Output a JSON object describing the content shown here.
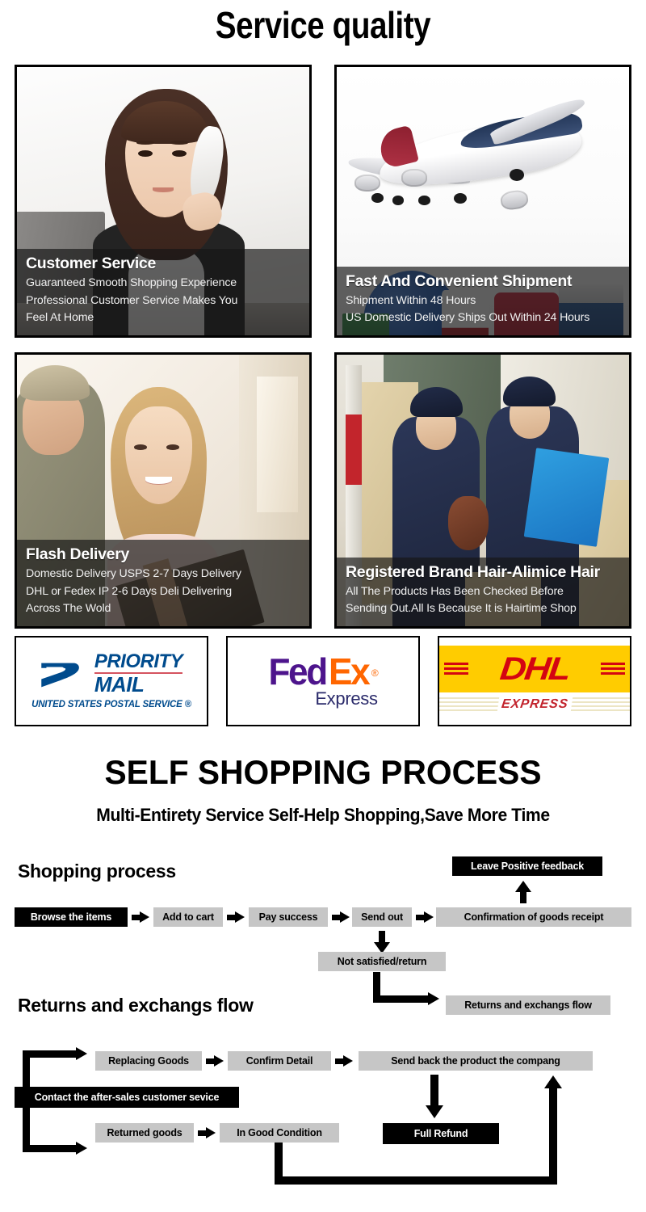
{
  "page": {
    "main_title": "Service quality"
  },
  "feature_cards": [
    {
      "id": "customer-service",
      "title": "Customer Service",
      "lines": [
        "Guaranteed Smooth Shopping Experience",
        "Professional Customer Service Makes You",
        "Feel At Home"
      ],
      "image_description": "customer-service-representative-on-phone"
    },
    {
      "id": "fast-shipment",
      "title": "Fast And Convenient Shipment",
      "lines": [
        "Shipment Within 48 Hours",
        "US Domestic Delivery Ships Out Within 24 Hours"
      ],
      "image_description": "airplane-globe-ship-truck-logistics"
    },
    {
      "id": "flash-delivery",
      "title": "Flash Delivery",
      "lines": [
        "Domestic Delivery USPS 2-7 Days Delivery",
        "DHL or Fedex IP 2-6 Days Deli Delivering",
        "Across The Wold"
      ],
      "image_description": "courier-handing-package-to-woman-at-door"
    },
    {
      "id": "registered-brand",
      "title": "Registered Brand Hair-Alimice Hair",
      "lines": [
        "All The Products Has Been Checked Before",
        "Sending Out.All Is Because It is Hairtime Shop"
      ],
      "image_description": "customs-inspectors-checking-products"
    }
  ],
  "courier_logos": [
    {
      "id": "usps",
      "name_line1": "PRIORITY",
      "name_line2": "MAIL",
      "subtitle": "UNITED STATES POSTAL SERVICE ®",
      "color": "#004b8d"
    },
    {
      "id": "fedex",
      "fed": "Fed",
      "ex": "Ex",
      "registered": "®",
      "express": "Express",
      "fed_color": "#4D148C",
      "ex_color": "#FF6600"
    },
    {
      "id": "dhl",
      "name": "DHL",
      "express": "EXPRESS",
      "band_color": "#FFCC00",
      "text_color": "#D40511"
    }
  ],
  "self_shopping": {
    "title": "SELF SHOPPING PROCESS",
    "subtitle": "Multi-Entirety Service Self-Help Shopping,Save More Time"
  },
  "shopping_flow": {
    "heading": "Shopping process",
    "nodes": [
      {
        "id": "browse-the-items",
        "label": "Browse the items",
        "style": "black"
      },
      {
        "id": "add-to-cart",
        "label": "Add to cart",
        "style": "gray"
      },
      {
        "id": "pay-success",
        "label": "Pay success",
        "style": "gray"
      },
      {
        "id": "send-out",
        "label": "Send out",
        "style": "gray"
      },
      {
        "id": "confirmation-of-goods-receipt",
        "label": "Confirmation of goods receipt",
        "style": "gray"
      },
      {
        "id": "leave-positive-feedback",
        "label": "Leave Positive feedback",
        "style": "black"
      },
      {
        "id": "not-satisfied-return",
        "label": "Not satisfied/return",
        "style": "gray"
      },
      {
        "id": "returns-and-exchangs-flow-node",
        "label": "Returns and exchangs flow",
        "style": "gray"
      }
    ]
  },
  "returns_flow": {
    "heading": "Returns and exchangs flow",
    "nodes": [
      {
        "id": "contact-the-after-sales-customer-sevice",
        "label": "Contact the after-sales customer sevice",
        "style": "black"
      },
      {
        "id": "replacing-goods",
        "label": "Replacing Goods",
        "style": "gray"
      },
      {
        "id": "confirm-detail",
        "label": "Confirm Detail",
        "style": "gray"
      },
      {
        "id": "send-back-the-product-the-compang",
        "label": "Send back the product the compang",
        "style": "gray"
      },
      {
        "id": "returned-goods",
        "label": "Returned goods",
        "style": "gray"
      },
      {
        "id": "in-good-condition",
        "label": "In Good Condition",
        "style": "gray"
      },
      {
        "id": "full-refund",
        "label": "Full Refund",
        "style": "black"
      }
    ]
  },
  "colors": {
    "node_gray": "#c6c6c6",
    "node_black": "#000000",
    "border": "#000000",
    "background": "#ffffff"
  }
}
